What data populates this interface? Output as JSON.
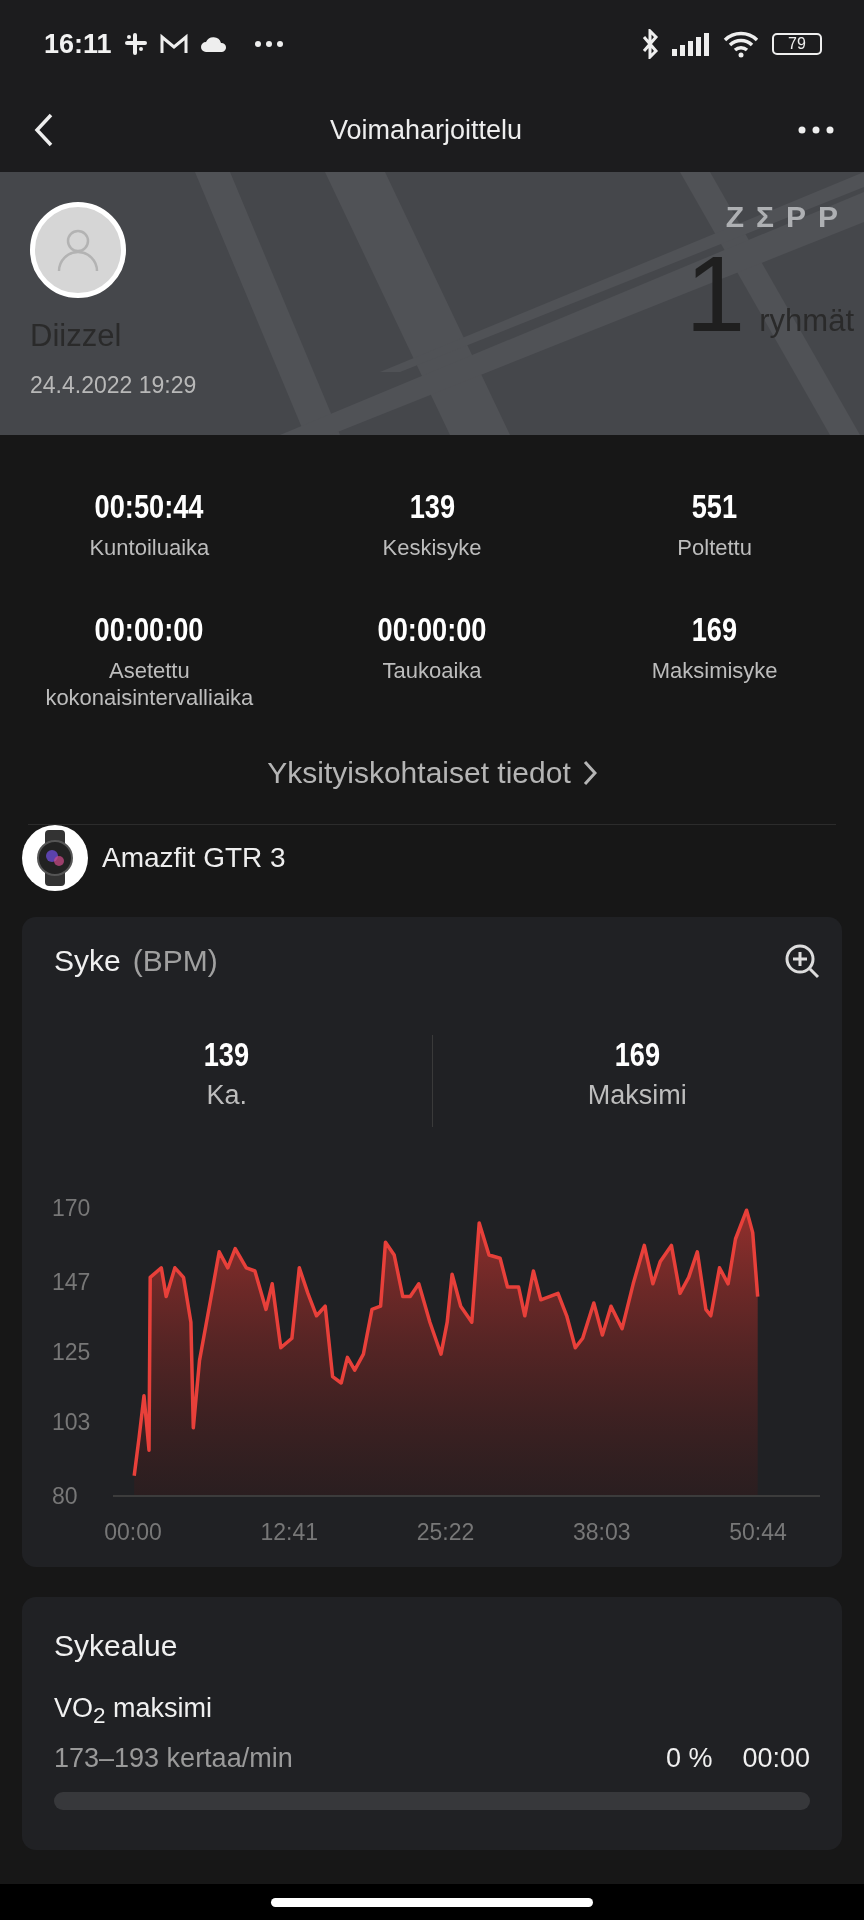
{
  "status_bar": {
    "time": "16:11",
    "battery": "79"
  },
  "header": {
    "title": "Voimaharjoittelu"
  },
  "banner": {
    "user": "Diizzel",
    "date": "24.4.2022 19:29",
    "logo": "ZΣPP",
    "count": "1",
    "count_unit": "ryhmät"
  },
  "stats": [
    {
      "value": "00:50:44",
      "label": "Kuntoiluaika"
    },
    {
      "value": "139",
      "label": "Keskisyke"
    },
    {
      "value": "551",
      "label": "Poltettu"
    },
    {
      "value": "00:00:00",
      "label": "Asetettu kokonaisintervalliaika"
    },
    {
      "value": "00:00:00",
      "label": "Taukoaika"
    },
    {
      "value": "169",
      "label": "Maksimisyke"
    }
  ],
  "details_link": "Yksityiskohtaiset tiedot",
  "device": {
    "name": "Amazfit GTR 3"
  },
  "heart_rate": {
    "title": "Syke",
    "unit": "(BPM)",
    "summary": [
      {
        "value": "139",
        "label": "Ka."
      },
      {
        "value": "169",
        "label": "Maksimi"
      }
    ],
    "chart_data": {
      "type": "area",
      "ylim": [
        80,
        170
      ],
      "yticks": [
        80,
        103,
        125,
        147,
        170
      ],
      "xlim": [
        -1.62,
        55.76
      ],
      "xticks": [
        {
          "value": 0,
          "label": "00:00"
        },
        {
          "value": 12.68,
          "label": "12:41"
        },
        {
          "value": 25.37,
          "label": "25:22"
        },
        {
          "value": 38.05,
          "label": "38:03"
        },
        {
          "value": 50.73,
          "label": "50:44"
        }
      ],
      "x": [
        0.1,
        0.5,
        0.9,
        1.3,
        1.4,
        2.3,
        2.7,
        3.4,
        4.1,
        4.7,
        4.9,
        5.4,
        6.3,
        7.0,
        7.7,
        8.3,
        9.2,
        9.9,
        10.8,
        11.3,
        12.0,
        12.9,
        13.5,
        14.2,
        14.9,
        15.6,
        16.2,
        16.9,
        17.4,
        18.0,
        18.7,
        19.4,
        20.1,
        20.5,
        21.2,
        21.9,
        22.5,
        23.2,
        24.1,
        25.0,
        25.5,
        25.9,
        26.6,
        27.5,
        28.1,
        28.9,
        29.8,
        30.4,
        31.3,
        31.8,
        32.5,
        33.1,
        33.8,
        34.5,
        35.2,
        35.9,
        36.5,
        37.4,
        38.1,
        38.8,
        39.7,
        40.6,
        41.5,
        42.2,
        42.8,
        43.7,
        44.4,
        45.1,
        45.8,
        46.5,
        46.9,
        47.6,
        48.3,
        48.9,
        49.8,
        50.3,
        50.7
      ],
      "series": [
        {
          "color": "#e8403a",
          "values": [
            86,
            98,
            111,
            94,
            148,
            151,
            142,
            151,
            148,
            134,
            101,
            122,
            141,
            156,
            151,
            157,
            151,
            150,
            138,
            146,
            126,
            129,
            151,
            143,
            136,
            139,
            117,
            115,
            123,
            119,
            124,
            138,
            139,
            159,
            155,
            142,
            142,
            146,
            134,
            124,
            134,
            149,
            139,
            134,
            165,
            155,
            154,
            145,
            145,
            136,
            150,
            141,
            142,
            143,
            136,
            126,
            129,
            140,
            130,
            139,
            132,
            146,
            158,
            146,
            153,
            158,
            143,
            148,
            156,
            138,
            136,
            151,
            146,
            160,
            169,
            162,
            142
          ]
        }
      ]
    }
  },
  "zones": {
    "title": "Sykealue",
    "items": [
      {
        "name": "VO$_{2}$ maksimi",
        "range": "173–193 kertaa/min",
        "percent": "0 %",
        "time": "00:00",
        "level": 0
      }
    ]
  }
}
